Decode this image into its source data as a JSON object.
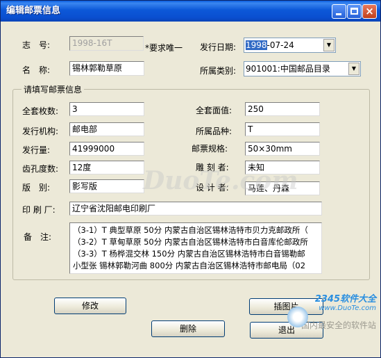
{
  "window": {
    "title": "编辑邮票信息",
    "close_glyph": "×"
  },
  "top": {
    "serial_label": "志　号:",
    "serial_value": "1998-16T",
    "unique_note": "*要求唯一",
    "issue_date_label": "发行日期:",
    "issue_date_selected": "1998",
    "issue_date_rest": "-07-24",
    "name_label": "名　称:",
    "name_value": "锡林郭勒草原",
    "category_label": "所属类别:",
    "category_value": "901001:中国邮品目录"
  },
  "group": {
    "title": "请填写邮票信息",
    "set_count_label": "全套枚数:",
    "set_count_value": "3",
    "face_value_label": "全套面值:",
    "face_value_value": "250",
    "issuer_label": "发行机构:",
    "issuer_value": "邮电部",
    "variety_label": "所属品种:",
    "variety_value": "T",
    "quantity_label": "发行量:",
    "quantity_value": "41999000",
    "size_label": "邮票规格:",
    "size_value": "50×30mm",
    "perforation_label": "齿孔度数:",
    "perforation_value": "12度",
    "engraver_label": "雕 刻 者:",
    "engraver_value": "未知",
    "edition_label": "版　别:",
    "edition_value": "影写版",
    "designer_label": "设 计 者:",
    "designer_value": "马莲、丹森",
    "printer_label": "印 刷 厂:",
    "printer_value": "辽宁省沈阳邮电印刷厂",
    "remarks_label": "备　注:",
    "remarks_lines": [
      "（3-1）T 典型草原 50分  内蒙古自治区锡林浩特市贝力克邮政所（",
      "（3-2）T 草甸草原 50分  内蒙古自治区锡林浩特市白音库伦邮政所",
      "（3-3）T 杨桦混交林 150分  内蒙古自治区锡林浩特市白音锡勒邮",
      "小型张 锡林郭勒河曲 800分  内蒙古自治区锡林浩特市邮电局（02"
    ]
  },
  "buttons": {
    "modify": "修改",
    "insert_image": "插图片",
    "delete": "删除",
    "exit": "退出"
  },
  "watermark": {
    "main": "DuoTe.com",
    "logo": "2345软件大全",
    "url": "www.DuoTe.com",
    "slogan": "国内最安全的软件站"
  }
}
